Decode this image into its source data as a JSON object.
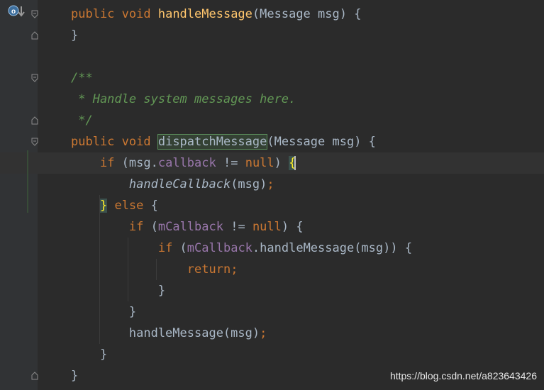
{
  "editor": {
    "lines": [
      {
        "tokens": [
          [
            "kw",
            "public "
          ],
          [
            "kw",
            "void "
          ],
          [
            "fn",
            "handleMessage"
          ],
          [
            "plain",
            "(Message msg) {"
          ]
        ]
      },
      {
        "tokens": [
          [
            "plain",
            "}"
          ]
        ]
      },
      {
        "tokens": []
      },
      {
        "tokens": [
          [
            "cmt",
            "/**"
          ]
        ]
      },
      {
        "tokens": [
          [
            "cmt",
            " * Handle system messages here."
          ]
        ]
      },
      {
        "tokens": [
          [
            "cmt",
            " */"
          ]
        ]
      },
      {
        "tokens": [
          [
            "kw",
            "public "
          ],
          [
            "kw",
            "void "
          ],
          [
            "hl",
            "dispatchMessage"
          ],
          [
            "plain",
            "(Message msg) {"
          ]
        ]
      },
      {
        "tokens": [
          [
            "plain",
            "    "
          ],
          [
            "kw",
            "if "
          ],
          [
            "plain",
            "(msg."
          ],
          [
            "field",
            "callback"
          ],
          [
            "plain",
            " != "
          ],
          [
            "kw",
            "null"
          ],
          [
            "plain",
            ") "
          ],
          [
            "bm",
            "{"
          ]
        ]
      },
      {
        "tokens": [
          [
            "plain",
            "        "
          ],
          [
            "italic",
            "handleCallback"
          ],
          [
            "plain",
            "(msg)"
          ],
          [
            "punc",
            ";"
          ]
        ]
      },
      {
        "tokens": [
          [
            "plain",
            "    "
          ],
          [
            "bm",
            "}"
          ],
          [
            "plain",
            " "
          ],
          [
            "kw",
            "else "
          ],
          [
            "plain",
            "{"
          ]
        ]
      },
      {
        "tokens": [
          [
            "plain",
            "        "
          ],
          [
            "kw",
            "if "
          ],
          [
            "plain",
            "("
          ],
          [
            "field",
            "mCallback"
          ],
          [
            "plain",
            " != "
          ],
          [
            "kw",
            "null"
          ],
          [
            "plain",
            ") {"
          ]
        ]
      },
      {
        "tokens": [
          [
            "plain",
            "            "
          ],
          [
            "kw",
            "if "
          ],
          [
            "plain",
            "("
          ],
          [
            "field",
            "mCallback"
          ],
          [
            "plain",
            ".handleMessage(msg)) {"
          ]
        ]
      },
      {
        "tokens": [
          [
            "plain",
            "                "
          ],
          [
            "kw",
            "return"
          ],
          [
            "punc",
            ";"
          ]
        ]
      },
      {
        "tokens": [
          [
            "plain",
            "            }"
          ]
        ]
      },
      {
        "tokens": [
          [
            "plain",
            "        }"
          ]
        ]
      },
      {
        "tokens": [
          [
            "plain",
            "        handleMessage(msg)"
          ],
          [
            "punc",
            ";"
          ]
        ]
      },
      {
        "tokens": [
          [
            "plain",
            "    }"
          ]
        ]
      },
      {
        "tokens": [
          [
            "plain",
            "}"
          ]
        ]
      }
    ],
    "current_line": 7,
    "gutter_icons": [
      {
        "line": 0,
        "icon": "override-method-icon"
      }
    ],
    "fold_markers": [
      0,
      1,
      3,
      5,
      6,
      17
    ]
  },
  "watermark": "https://blog.csdn.net/a823643426",
  "colors": {
    "background": "#2b2b2b",
    "keyword": "#cc7832",
    "function": "#ffc66d",
    "field": "#9876aa",
    "comment": "#629755",
    "text": "#a9b7c6"
  }
}
